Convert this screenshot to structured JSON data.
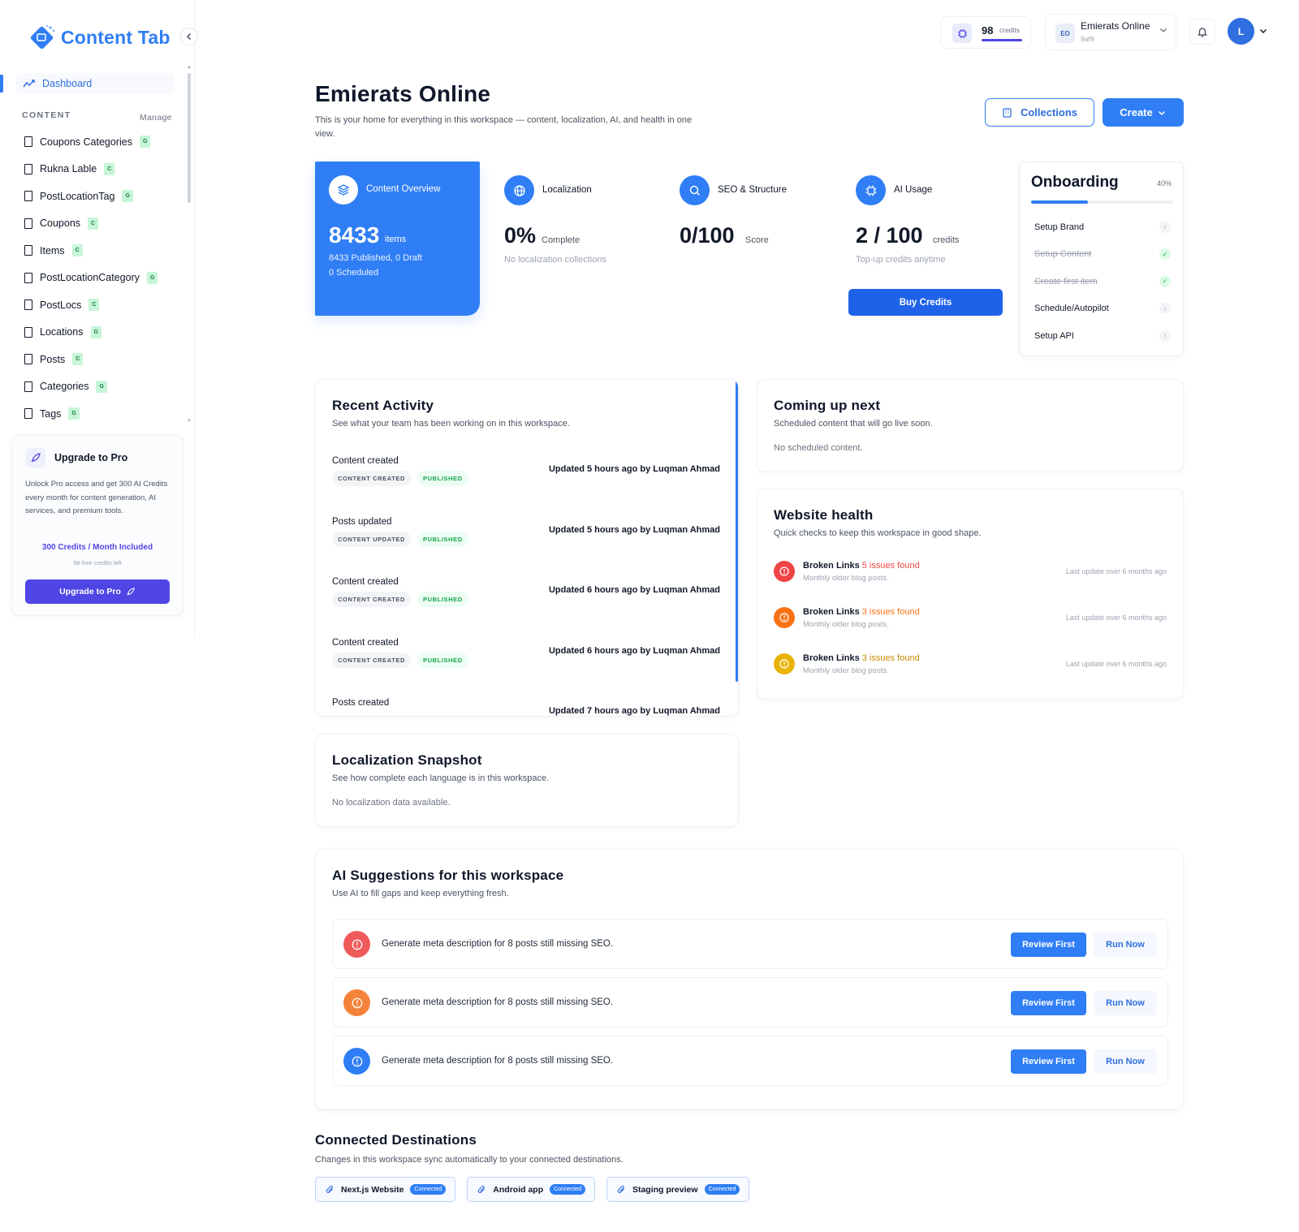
{
  "app": {
    "name": "Content Tab",
    "brand_color": "#2f7ef5"
  },
  "sidebar": {
    "dashboard_label": "Dashboard",
    "section_title": "CONTENT",
    "section_action": "Manage",
    "items": [
      {
        "label": "Coupons Categories",
        "badge": "G"
      },
      {
        "label": "Rukna Lable",
        "badge": "C"
      },
      {
        "label": "PostLocationTag",
        "badge": "G"
      },
      {
        "label": "Coupons",
        "badge": "C"
      },
      {
        "label": "Items",
        "badge": "C"
      },
      {
        "label": "PostLocationCategory",
        "badge": "G"
      },
      {
        "label": "PostLocs",
        "badge": "C"
      },
      {
        "label": "Locations",
        "badge": "G"
      },
      {
        "label": "Posts",
        "badge": "C"
      },
      {
        "label": "Categories",
        "badge": "G"
      },
      {
        "label": "Tags",
        "badge": "G"
      }
    ],
    "upgrade": {
      "title": "Upgrade to Pro",
      "description": "Unlock Pro access and get 300 AI Credits every month for content generation, AI services, and premium tools.",
      "credits_line": "300 Credits / Month Included",
      "credits_left": "98 free credits left",
      "button_label": "Upgrade to Pro"
    }
  },
  "topbar": {
    "credits_value": "98",
    "credits_unit": "credits",
    "workspace_initials": "EO",
    "workspace_name": "Emierats Online",
    "workspace_id": "9af9",
    "avatar_initial": "L"
  },
  "header": {
    "title": "Emierats Online",
    "subtitle": "This is your home for everything in this workspace — content, localization, AI, and health in one view.",
    "collections_label": "Collections",
    "create_label": "Create"
  },
  "stats": {
    "content": {
      "label": "Content Overview",
      "value": "8433",
      "unit": "items",
      "line1": "8433 Published, 0 Draft",
      "line2": "0 Scheduled"
    },
    "localization": {
      "label": "Localization",
      "value": "0%",
      "unit": "Complete",
      "desc": "No localization collections"
    },
    "seo": {
      "label": "SEO & Structure",
      "value": "0/100",
      "unit": "Score"
    },
    "ai": {
      "label": "AI Usage",
      "value": "2 / 100",
      "unit": "credits",
      "desc": "Top-up credits anytime",
      "button": "Buy Credits"
    }
  },
  "onboarding": {
    "title": "Onboarding",
    "percent_label": "40%",
    "progress": 0.4,
    "steps": [
      {
        "label": "Setup Brand",
        "done": false
      },
      {
        "label": "Setup Content",
        "done": true
      },
      {
        "label": "Create first item",
        "done": true
      },
      {
        "label": "Schedule/Autopilot",
        "done": false
      },
      {
        "label": "Setup API",
        "done": false
      }
    ]
  },
  "activity": {
    "title": "Recent Activity",
    "subtitle": "See what your team has been working on in this workspace.",
    "items": [
      {
        "title": "Content created",
        "tag1": "CONTENT CREATED",
        "tag2": "PUBLISHED",
        "meta": "Updated 5 hours ago by Luqman Ahmad"
      },
      {
        "title": "Posts updated",
        "tag1": "CONTENT UPDATED",
        "tag2": "PUBLISHED",
        "meta": "Updated 5 hours ago by Luqman Ahmad"
      },
      {
        "title": "Content created",
        "tag1": "CONTENT CREATED",
        "tag2": "PUBLISHED",
        "meta": "Updated 6 hours ago by Luqman Ahmad"
      },
      {
        "title": "Content created",
        "tag1": "CONTENT CREATED",
        "tag2": "PUBLISHED",
        "meta": "Updated 6 hours ago by Luqman Ahmad"
      },
      {
        "title": "Posts created",
        "tag1": "",
        "tag2": "",
        "meta": "Updated 7 hours ago by Luqman Ahmad"
      }
    ]
  },
  "coming_up": {
    "title": "Coming up next",
    "subtitle": "Scheduled content that will go live soon.",
    "empty": "No scheduled content."
  },
  "health": {
    "title": "Website health",
    "subtitle": "Quick checks to keep this workspace in good shape.",
    "items": [
      {
        "label": "Broken Links",
        "issues": "5 issues found",
        "desc": "Monthly older blog posts.",
        "updated": "Last update over 6 months ago",
        "color": "#ef4444"
      },
      {
        "label": "Broken Links",
        "issues": "3 issues found",
        "desc": "Monthly older blog posts.",
        "updated": "Last update over 6 months ago",
        "color": "#f97316"
      },
      {
        "label": "Broken Links",
        "issues": "3 issues found",
        "desc": "Monthly older blog posts.",
        "updated": "Last update over 6 months ago",
        "color": "#eab308"
      }
    ]
  },
  "localization_snapshot": {
    "title": "Localization Snapshot",
    "subtitle": "See how complete each language is in this workspace.",
    "empty": "No localization data available."
  },
  "ai_suggestions": {
    "title": "AI Suggestions for this workspace",
    "subtitle": "Use AI to fill gaps and keep everything fresh.",
    "items": [
      {
        "text": "Generate meta description for 8 posts still missing SEO.",
        "review": "Review First",
        "run": "Run Now",
        "color": "#ef5a5a"
      },
      {
        "text": "Generate meta description for 8 posts still missing SEO.",
        "review": "Review First",
        "run": "Run Now",
        "color": "#f5823b"
      },
      {
        "text": "Generate meta description for 8 posts still missing SEO.",
        "review": "Review First",
        "run": "Run Now",
        "color": "#2f7ef5"
      }
    ]
  },
  "destinations": {
    "title": "Connected Destinations",
    "subtitle": "Changes in this workspace sync automatically to your connected destinations.",
    "items": [
      {
        "name": "Next.js Website",
        "status": "Connected"
      },
      {
        "name": "Android app",
        "status": "Connected"
      },
      {
        "name": "Staging preview",
        "status": "Connected"
      }
    ]
  }
}
